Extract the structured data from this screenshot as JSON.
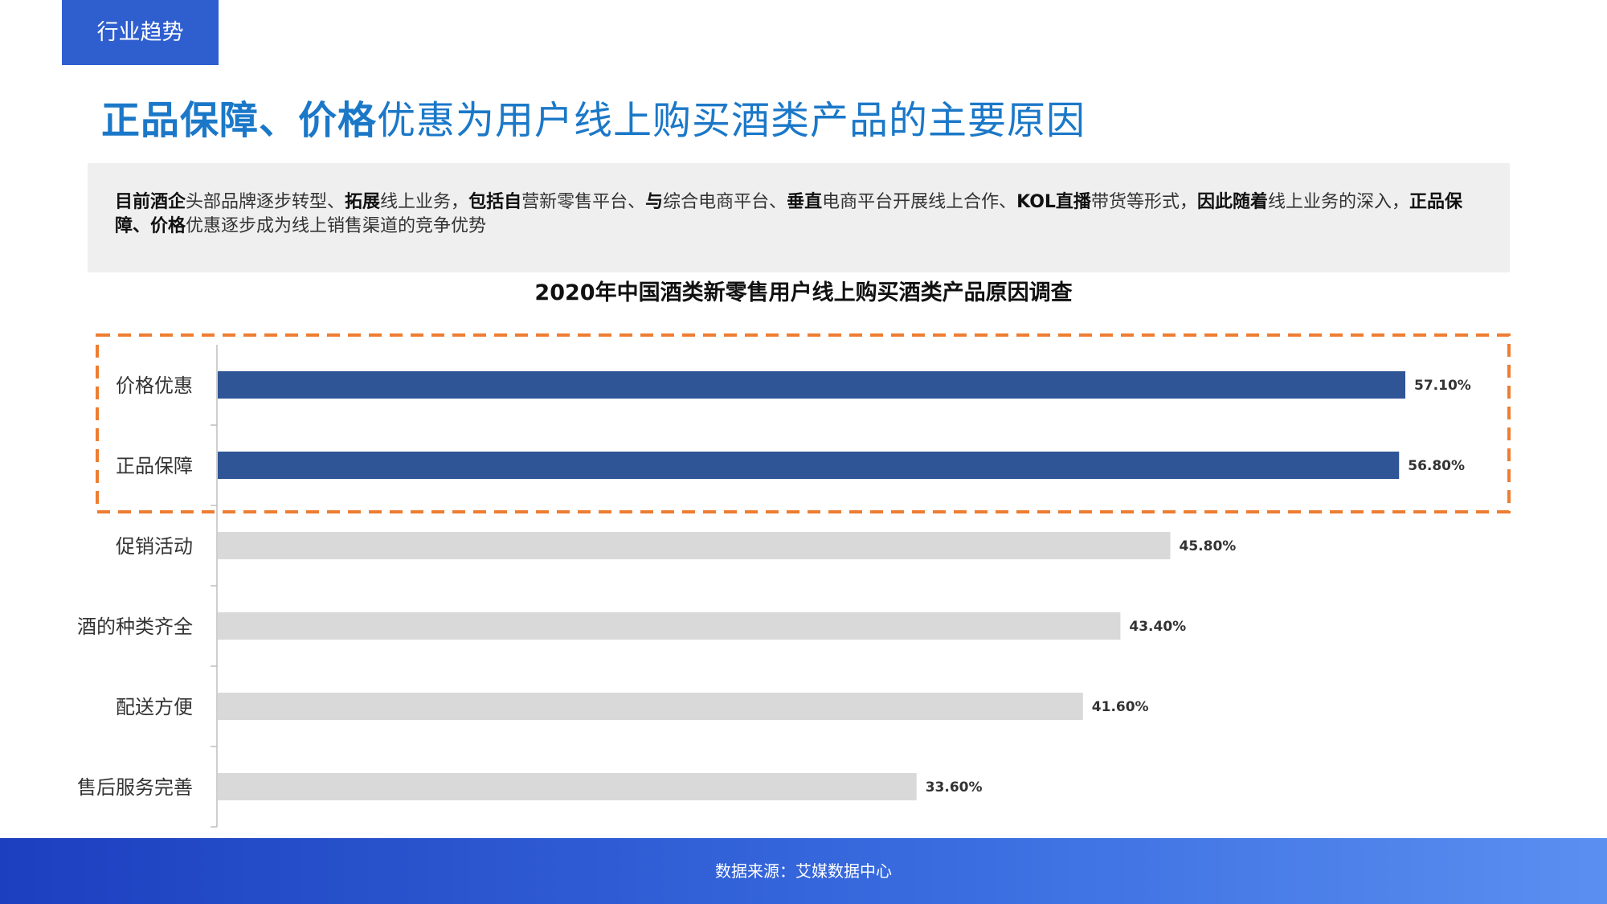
{
  "section_tag": "行业趋势",
  "headline": {
    "bold_part1": "正品保障、价格",
    "rest": "优惠为用户线上购买酒类产品的主要原因"
  },
  "summary": {
    "b1": "目前酒企",
    "t1": "头部品牌逐步转型、",
    "b2": "拓展",
    "t2": "线上业务，",
    "b3": "包括自",
    "t3": "营新零售平台、",
    "b4": "与",
    "t4": "综合电商平台、",
    "b5": "垂直",
    "t5": "电商平台开展线上合作、",
    "b6": "KOL直播",
    "t6": "带货等形式，",
    "b7": "因此随着",
    "t7": "线上业务的深入，",
    "b8": "正品保障、价格",
    "t8": "优惠逐步成为线上销售渠道的竞争优势"
  },
  "footer": "数据来源：艾媒数据中心",
  "colors": {
    "highlight_bar": "#2f5597",
    "normal_bar": "#d9d9d9",
    "highlight_box": "#ed7d31"
  },
  "chart_data": {
    "type": "bar",
    "orientation": "horizontal",
    "title": "2020年中国酒类新零售用户线上购买酒类产品原因调查",
    "categories": [
      "价格优惠",
      "正品保障",
      "促销活动",
      "酒的种类齐全",
      "配送方便",
      "售后服务完善"
    ],
    "values": [
      57.1,
      56.8,
      45.8,
      43.4,
      41.6,
      33.6
    ],
    "value_labels": [
      "57.10%",
      "56.80%",
      "45.80%",
      "43.40%",
      "41.60%",
      "33.60%"
    ],
    "highlighted": [
      true,
      true,
      false,
      false,
      false,
      false
    ],
    "xlim": [
      0,
      60
    ],
    "grid": false,
    "legend": "none"
  }
}
